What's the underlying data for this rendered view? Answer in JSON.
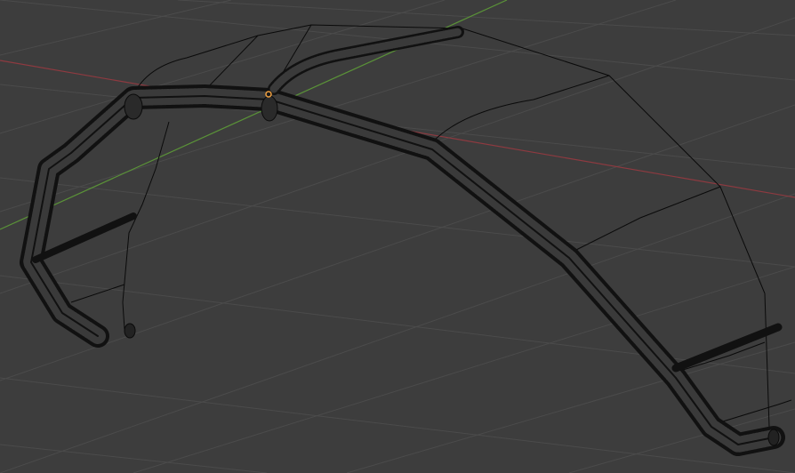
{
  "viewport": {
    "background_color": "#3d3d3d",
    "grid_color": "#4a4a4a",
    "x_axis_color": "#9b3f45",
    "y_axis_color": "#5e9a3d",
    "wire_color": "#0a0a0a",
    "origin_color": "#f0a040"
  }
}
